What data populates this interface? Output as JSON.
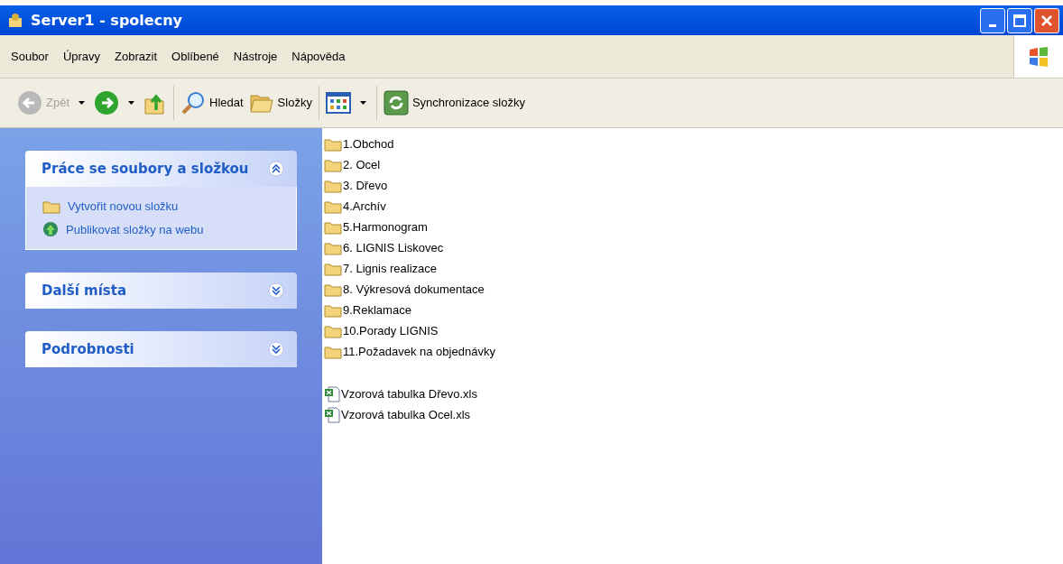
{
  "window": {
    "title": "Server1 - spolecny"
  },
  "menu": [
    "Soubor",
    "Úpravy",
    "Zobrazit",
    "Oblíbené",
    "Nástroje",
    "Nápověda"
  ],
  "toolbar": [
    {
      "kind": "back",
      "label": "Zpět",
      "disabled": true
    },
    {
      "kind": "forward",
      "disabled": false
    },
    {
      "kind": "up",
      "disabled": false
    },
    {
      "kind": "search",
      "label": "Hledat",
      "disabled": false
    },
    {
      "kind": "folders",
      "label": "Složky",
      "disabled": false
    },
    {
      "kind": "views",
      "disabled": false
    },
    {
      "kind": "sync",
      "label": "Synchronizace složky",
      "disabled": false
    }
  ],
  "sidebar": [
    {
      "title": "Práce se soubory a složkou",
      "expanded": true,
      "tasks": [
        {
          "kind": "new-folder",
          "label": "Vytvořit novou složku"
        },
        {
          "kind": "publish",
          "label": "Publikovat složky na webu"
        }
      ]
    },
    {
      "title": "Další místa",
      "expanded": false
    },
    {
      "title": "Podrobnosti",
      "expanded": false
    }
  ],
  "folders": [
    "1.Obchod",
    "2. Ocel",
    "3. Dřevo",
    "4.Archív",
    "5.Harmonogram",
    "6. LIGNIS Liskovec",
    "7. Lignis realizace",
    "8. Výkresová dokumentace",
    "9.Reklamace",
    "10.Porady LIGNIS",
    "11.Požadavek na objednávky"
  ],
  "files": [
    "Vzorová tabulka Dřevo.xls",
    "Vzorová tabulka Ocel.xls"
  ]
}
